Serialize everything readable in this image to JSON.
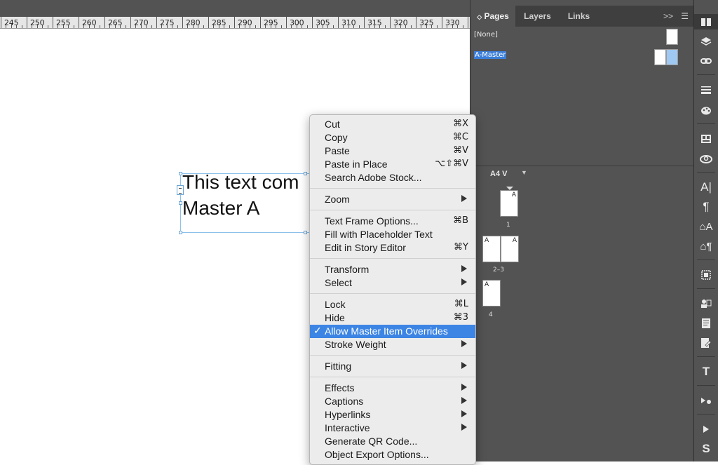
{
  "ruler": {
    "labels": [
      "245",
      "250",
      "255",
      "260",
      "265",
      "270",
      "275",
      "280",
      "285",
      "290",
      "295",
      "300",
      "305",
      "310",
      "315",
      "320",
      "325",
      "330"
    ]
  },
  "frame": {
    "text": "This text com\nMaster A"
  },
  "panel": {
    "tabs": [
      {
        "label": "Pages"
      },
      {
        "label": "Layers"
      },
      {
        "label": "Links"
      }
    ],
    "masters": [
      {
        "label": "[None]"
      },
      {
        "label": "A-Master"
      }
    ],
    "page_size": "A4 V",
    "page_groups": [
      {
        "label": "1"
      },
      {
        "label": "2–3"
      },
      {
        "label": "4"
      }
    ],
    "master_letter": "A"
  },
  "menu": {
    "items": [
      {
        "label": "Cut",
        "shortcut": "⌘X"
      },
      {
        "label": "Copy",
        "shortcut": "⌘C"
      },
      {
        "label": "Paste",
        "shortcut": "⌘V"
      },
      {
        "label": "Paste in Place",
        "shortcut": "⌥⇧⌘V"
      },
      {
        "label": "Search Adobe Stock...",
        "shortcut": ""
      },
      {
        "label": "Zoom",
        "shortcut": ""
      },
      {
        "label": "Text Frame Options...",
        "shortcut": "⌘B"
      },
      {
        "label": "Fill with Placeholder Text",
        "shortcut": ""
      },
      {
        "label": "Edit in Story Editor",
        "shortcut": "⌘Y"
      },
      {
        "label": "Transform",
        "shortcut": ""
      },
      {
        "label": "Select",
        "shortcut": ""
      },
      {
        "label": "Lock",
        "shortcut": "⌘L"
      },
      {
        "label": "Hide",
        "shortcut": "⌘3"
      },
      {
        "label": "Allow Master Item Overrides",
        "shortcut": "",
        "checked": true
      },
      {
        "label": "Stroke Weight",
        "shortcut": ""
      },
      {
        "label": "Fitting",
        "shortcut": ""
      },
      {
        "label": "Effects",
        "shortcut": ""
      },
      {
        "label": "Captions",
        "shortcut": ""
      },
      {
        "label": "Hyperlinks",
        "shortcut": ""
      },
      {
        "label": "Interactive",
        "shortcut": ""
      },
      {
        "label": "Generate QR Code...",
        "shortcut": ""
      },
      {
        "label": "Object Export Options...",
        "shortcut": ""
      }
    ]
  },
  "colors": {
    "highlight": "#3c85e4",
    "panel": "#535353",
    "frame_border": "#8ec1ea"
  }
}
